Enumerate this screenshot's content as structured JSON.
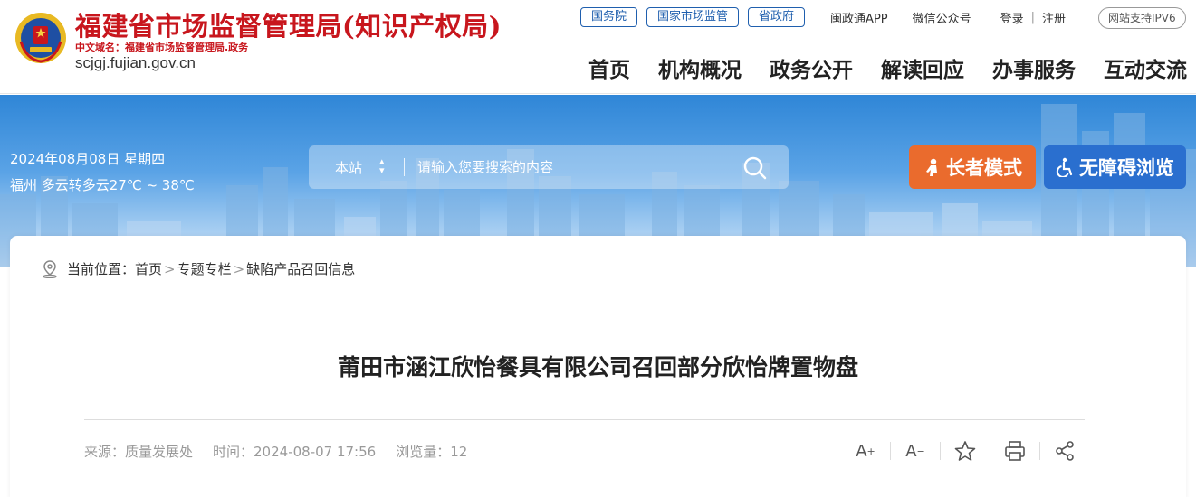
{
  "header": {
    "site_title": "福建省市场监督管理局(知识产权局)",
    "cn_domain": "中文域名：福建省市场监督管理局.政务",
    "domain": "scjgj.fujian.gov.cn",
    "top_links": {
      "pills": [
        "国务院",
        "国家市场监管",
        "省政府"
      ],
      "app": "闽政通APP",
      "wechat": "微信公众号",
      "login": "登录",
      "sep": "|",
      "register": "注册",
      "ipv6": "网站支持IPV6"
    },
    "nav": [
      "首页",
      "机构概况",
      "政务公开",
      "解读回应",
      "办事服务",
      "互动交流"
    ]
  },
  "banner": {
    "date": "2024年08月08日 星期四",
    "weather": "福州 多云转多云27℃ ~ 38℃",
    "search": {
      "scope": "本站",
      "scope_arrow": "▲\n▼",
      "placeholder": "请输入您要搜索的内容",
      "button_icon": "search-icon"
    },
    "elder_mode": "长者模式",
    "accessibility": "无障碍浏览"
  },
  "content": {
    "breadcrumb": {
      "label": "当前位置：",
      "items": [
        "首页",
        "专题专栏",
        "缺陷产品召回信息"
      ],
      "sep": ">"
    },
    "title": "莆田市涵江欣怡餐具有限公司召回部分欣怡牌置物盘",
    "meta": {
      "source": "来源：质量发展处",
      "time": "时间：2024-08-07 17:56",
      "views": "浏览量：12"
    },
    "tools": {
      "font_up": "A",
      "font_down": "A",
      "icons": [
        "font-increase-icon",
        "font-decrease-icon",
        "star-icon",
        "print-icon",
        "share-icon"
      ]
    }
  },
  "colors": {
    "brand_red": "#c8161d",
    "brand_blue": "#1f5fae",
    "elder_orange": "#ea6b2d",
    "access_blue": "#2a6fcf"
  }
}
